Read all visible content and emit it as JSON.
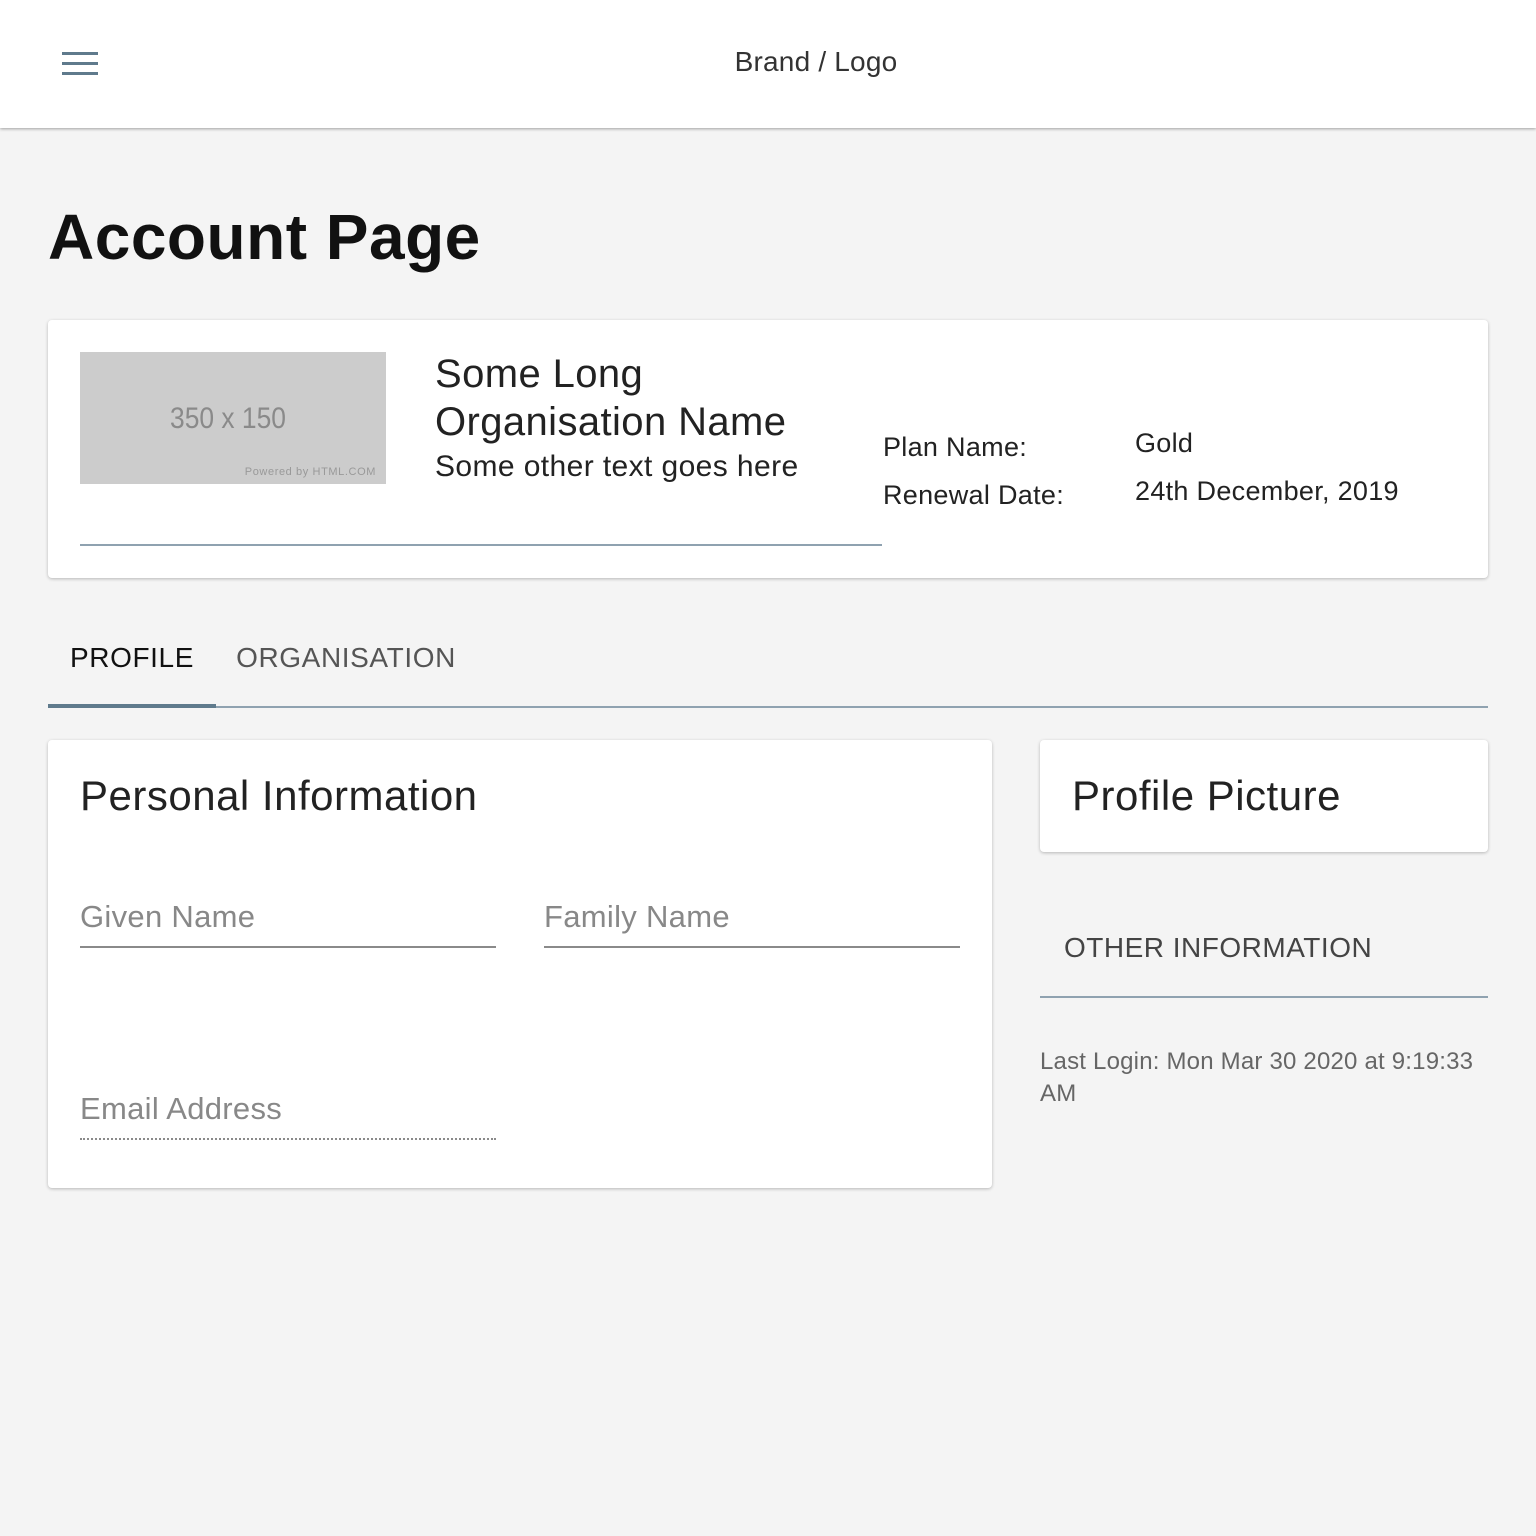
{
  "header": {
    "brand": "Brand / Logo",
    "menu_icon": "hamburger-menu-icon"
  },
  "page": {
    "title": "Account Page"
  },
  "organisation": {
    "image": {
      "dimensions_text": "350 x 150",
      "powered_text": "Powered by HTML.COM"
    },
    "name": "Some Long Organisation Name",
    "subtitle": "Some other text goes here",
    "plan_label": "Plan Name:",
    "plan_value": "Gold",
    "renewal_label": "Renewal Date:",
    "renewal_value": "24th December, 2019"
  },
  "tabs": [
    {
      "label": "PROFILE",
      "active": true
    },
    {
      "label": "ORGANISATION",
      "active": false
    }
  ],
  "personal_info": {
    "title": "Personal Information",
    "given_name": {
      "value": "",
      "placeholder": "Given Name"
    },
    "family_name": {
      "value": "",
      "placeholder": "Family Name"
    },
    "email": {
      "value": "",
      "placeholder": "Email Address"
    }
  },
  "profile_picture": {
    "title": "Profile Picture"
  },
  "other_information": {
    "label": "OTHER INFORMATION"
  },
  "last_login": "Last Login: Mon Mar 30 2020 at 9:19:33 AM",
  "colors": {
    "accent": "#5f7a8c",
    "divider": "#8fa2b0",
    "background": "#f4f4f4"
  }
}
